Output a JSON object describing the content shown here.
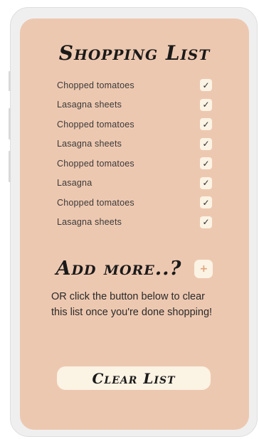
{
  "header": {
    "title": "Shopping List"
  },
  "list": {
    "items": [
      {
        "label": "Chopped tomatoes",
        "checked": true
      },
      {
        "label": "Lasagna sheets",
        "checked": true
      },
      {
        "label": "Chopped tomatoes",
        "checked": true
      },
      {
        "label": "Lasagna sheets",
        "checked": true
      },
      {
        "label": "Chopped tomatoes",
        "checked": true
      },
      {
        "label": "Lasagna",
        "checked": true
      },
      {
        "label": "Chopped tomatoes",
        "checked": true
      },
      {
        "label": "Lasagna sheets",
        "checked": true
      }
    ]
  },
  "add": {
    "title": "Add more..?",
    "button_icon": "+"
  },
  "description": "OR click the button below to clear this list once you're done shopping!",
  "clear": {
    "label": "Clear List"
  },
  "icons": {
    "check": "check-icon",
    "plus": "plus-icon"
  },
  "colors": {
    "card": "#edc8b0",
    "button": "#fbf3e4",
    "accent": "#e0a37c",
    "text": "#1a1a1a"
  }
}
